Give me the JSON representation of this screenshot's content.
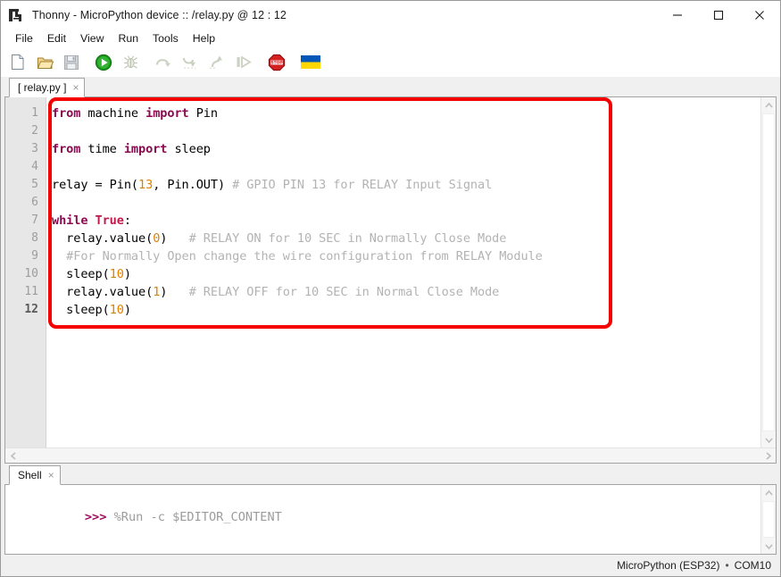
{
  "window": {
    "app_name": "Thonny",
    "title": "Thonny  -  MicroPython device :: /relay.py  @  12 : 12",
    "icon": "thonny-logo-icon",
    "controls": {
      "minimize": "minimize-icon",
      "maximize": "maximize-icon",
      "close": "close-icon"
    }
  },
  "menubar": {
    "items": [
      {
        "label": "File"
      },
      {
        "label": "Edit"
      },
      {
        "label": "View"
      },
      {
        "label": "Run"
      },
      {
        "label": "Tools"
      },
      {
        "label": "Help"
      }
    ]
  },
  "toolbar": {
    "buttons": [
      {
        "name": "new-file-icon",
        "tooltip": "New",
        "enabled": true
      },
      {
        "name": "open-file-icon",
        "tooltip": "Load",
        "enabled": true
      },
      {
        "name": "save-file-icon",
        "tooltip": "Save",
        "enabled": false
      },
      {
        "name": "run-icon",
        "tooltip": "Run current script",
        "enabled": true
      },
      {
        "name": "debug-icon",
        "tooltip": "Debug current script",
        "enabled": false
      },
      {
        "name": "step-over-icon",
        "tooltip": "Step over",
        "enabled": false
      },
      {
        "name": "step-into-icon",
        "tooltip": "Step into",
        "enabled": false
      },
      {
        "name": "step-out-icon",
        "tooltip": "Step out",
        "enabled": false
      },
      {
        "name": "resume-icon",
        "tooltip": "Resume",
        "enabled": false
      },
      {
        "name": "stop-icon",
        "tooltip": "Stop/Restart backend",
        "enabled": true
      },
      {
        "name": "ukraine-flag-icon",
        "tooltip": "Support Ukraine",
        "enabled": true
      }
    ]
  },
  "editor": {
    "tab": {
      "label": "[ relay.py ]",
      "close": "×"
    },
    "current_line": 12,
    "line_numbers": [
      "1",
      "2",
      "3",
      "4",
      "5",
      "6",
      "7",
      "8",
      "9",
      "10",
      "11",
      "12"
    ],
    "lines": [
      {
        "n": 1,
        "tokens": [
          {
            "t": "from ",
            "c": "kw"
          },
          {
            "t": "machine ",
            "c": ""
          },
          {
            "t": "import ",
            "c": "kw"
          },
          {
            "t": "Pin",
            "c": ""
          }
        ]
      },
      {
        "n": 2,
        "tokens": []
      },
      {
        "n": 3,
        "tokens": [
          {
            "t": "from ",
            "c": "kw"
          },
          {
            "t": "time ",
            "c": ""
          },
          {
            "t": "import ",
            "c": "kw"
          },
          {
            "t": "sleep",
            "c": ""
          }
        ]
      },
      {
        "n": 4,
        "tokens": []
      },
      {
        "n": 5,
        "tokens": [
          {
            "t": "relay = Pin(",
            "c": ""
          },
          {
            "t": "13",
            "c": "num"
          },
          {
            "t": ", Pin.OUT) ",
            "c": ""
          },
          {
            "t": "# GPIO PIN 13 for RELAY Input Signal",
            "c": "cmt"
          }
        ]
      },
      {
        "n": 6,
        "tokens": []
      },
      {
        "n": 7,
        "tokens": [
          {
            "t": "while ",
            "c": "kw"
          },
          {
            "t": "True",
            "c": "kw2"
          },
          {
            "t": ":",
            "c": ""
          }
        ]
      },
      {
        "n": 8,
        "tokens": [
          {
            "t": "  relay.value(",
            "c": ""
          },
          {
            "t": "0",
            "c": "num"
          },
          {
            "t": ")",
            "c": ""
          },
          {
            "t": "   # RELAY ON for 10 SEC in Normally Close Mode",
            "c": "cmt"
          }
        ]
      },
      {
        "n": 9,
        "tokens": [
          {
            "t": "  #For Normally Open change the wire configuration from RELAY Module",
            "c": "cmt"
          }
        ]
      },
      {
        "n": 10,
        "tokens": [
          {
            "t": "  sleep(",
            "c": ""
          },
          {
            "t": "10",
            "c": "num"
          },
          {
            "t": ")",
            "c": ""
          }
        ]
      },
      {
        "n": 11,
        "tokens": [
          {
            "t": "  relay.value(",
            "c": ""
          },
          {
            "t": "1",
            "c": "num"
          },
          {
            "t": ")",
            "c": ""
          },
          {
            "t": "   # RELAY OFF for 10 SEC in Normal Close Mode",
            "c": "cmt"
          }
        ]
      },
      {
        "n": 12,
        "tokens": [
          {
            "t": "  sleep(",
            "c": ""
          },
          {
            "t": "10",
            "c": "num"
          },
          {
            "t": ")",
            "c": ""
          }
        ]
      }
    ],
    "annotation": {
      "shape": "rounded-rectangle",
      "color": "#f50000"
    }
  },
  "shell": {
    "tab": {
      "label": "Shell",
      "close": "×"
    },
    "prompt": ">>>",
    "command": " %Run -c $EDITOR_CONTENT"
  },
  "statusbar": {
    "interpreter": "MicroPython (ESP32)",
    "separator": "•",
    "port": "COM10"
  },
  "colors": {
    "keyword": "#8b0a50",
    "builtin_const": "#c3184c",
    "number": "#e08000",
    "comment": "#b3b3b3",
    "prompt": "#9e0d5e",
    "annotation": "#f50000",
    "gutter_bg": "#e7e7e7"
  }
}
